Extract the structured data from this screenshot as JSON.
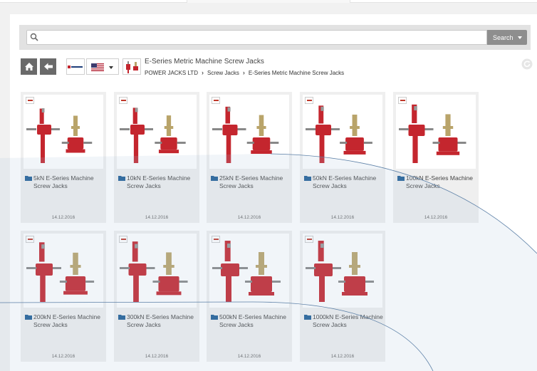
{
  "search": {
    "placeholder": "",
    "button_label": "Search"
  },
  "header": {
    "title": "E-Series Metric Machine Screw Jacks",
    "breadcrumb": [
      "POWER JACKS LTD",
      "Screw Jacks",
      "E-Series Metric Machine Screw Jacks"
    ]
  },
  "colors": {
    "jack_red": "#c4262e",
    "brass": "#b9a46a",
    "toolbar_button": "#6a6a6a",
    "search_button": "#8e8e8e",
    "folder": "#1f5e96"
  },
  "icons": {
    "home": "home-icon",
    "back": "arrow-left-icon",
    "search": "search-icon",
    "refresh": "refresh-icon",
    "folder": "folder-icon",
    "flag": "us-flag-icon"
  },
  "items": [
    {
      "label": "5kN E-Series Machine Screw Jacks",
      "date": "14.12.2016"
    },
    {
      "label": "10kN E-Series Machine Screw Jacks",
      "date": "14.12.2016"
    },
    {
      "label": "25kN E-Series Machine Screw Jacks",
      "date": "14.12.2016"
    },
    {
      "label": "50kN E-Series Machine Screw Jacks",
      "date": "14.12.2016"
    },
    {
      "label": "100kN E-Series Machine Screw Jacks",
      "date": "14.12.2016"
    },
    {
      "label": "200kN E-Series Machine Screw Jacks",
      "date": "14.12.2016"
    },
    {
      "label": "300kN E-Series Machine Screw Jacks",
      "date": "14.12.2016"
    },
    {
      "label": "500kN E-Series Machine Screw Jacks",
      "date": "14.12.2016"
    },
    {
      "label": "1000kN E-Series Machine Screw Jacks",
      "date": "14.12.2016"
    }
  ]
}
